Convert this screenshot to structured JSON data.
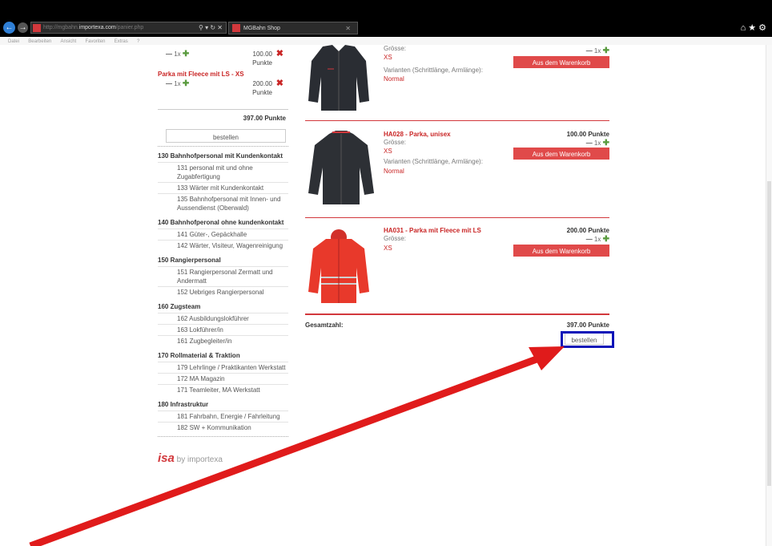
{
  "browser": {
    "url_prefix": "http://mgbahn.",
    "url_domain": "importexa.com",
    "url_path": "/panier.php",
    "tab_title": "MGBahn Shop",
    "menu": [
      "Datei",
      "Bearbeiten",
      "Ansicht",
      "Favoriten",
      "Extras",
      "?"
    ]
  },
  "sidebar": {
    "cart_items": [
      {
        "title": "",
        "qty": "1x",
        "points": "100.00",
        "unit": "Punkte"
      },
      {
        "title": "Parka mit Fleece mit LS - XS",
        "qty": "1x",
        "points": "200.00",
        "unit": "Punkte"
      }
    ],
    "total": "397.00 Punkte",
    "order_label": "bestellen",
    "categories": [
      {
        "title": "130 Bahnhofpersonal mit Kundenkontakt",
        "items": [
          "131 personal mit und ohne Zugabfertigung",
          "133 Wärter mit Kundenkontakt",
          "135 Bahnhofpersonal mit Innen- und Aussendienst (Oberwald)"
        ]
      },
      {
        "title": "140 Bahnhofperonal ohne kundenkontakt",
        "items": [
          "141 Güter-, Gepäckhalle",
          "142 Wärter, Visiteur, Wagenreinigung"
        ]
      },
      {
        "title": "150 Rangierpersonal",
        "items": [
          "151 Rangierpersonal Zermatt und Andermatt",
          "152 Uebriges Rangierpersonal"
        ]
      },
      {
        "title": "160 Zugsteam",
        "items": [
          "162 Ausbildungslokführer",
          "163 Lokführer/in",
          "161 Zugbegleiter/in"
        ]
      },
      {
        "title": "170 Rollmaterial & Traktion",
        "items": [
          "179 Lehrlinge / Praktikanten Werkstatt",
          "172 MA Magazin",
          "171 Teamleiter, MA Werkstatt"
        ]
      },
      {
        "title": "180 Infrastruktur",
        "items": [
          "181 Fahrbahn, Energie / Fahrleitung",
          "182 SW + Kommunikation"
        ]
      }
    ],
    "logo_mark": "isa",
    "logo_text": "by importexa"
  },
  "products": [
    {
      "title": "",
      "points": "",
      "size_label": "Grösse:",
      "size": "XS",
      "variant_label": "Varianten (Schrittlänge, Armlänge):",
      "variant": "Normal",
      "qty": "1x",
      "remove": "Aus dem Warenkorb entfernen",
      "color": "#2a2d33"
    },
    {
      "title": "HA028 - Parka, unisex",
      "points": "100.00 Punkte",
      "size_label": "Grösse:",
      "size": "XS",
      "variant_label": "Varianten (Schrittlänge, Armlänge):",
      "variant": "Normal",
      "qty": "1x",
      "remove": "Aus dem Warenkorb entfernen",
      "color": "#2d3035"
    },
    {
      "title": "HA031 - Parka mit Fleece mit LS",
      "points": "200.00 Punkte",
      "size_label": "Grösse:",
      "size": "XS",
      "qty": "1x",
      "remove": "Aus dem Warenkorb entfernen",
      "color": "#e8392b"
    }
  ],
  "summary": {
    "label": "Gesamtzahl:",
    "total": "397.00 Punkte",
    "order_label": "bestellen"
  },
  "colors": {
    "accent": "#d2383c",
    "highlight": "#0c14b8",
    "arrow": "#e01b1b"
  }
}
